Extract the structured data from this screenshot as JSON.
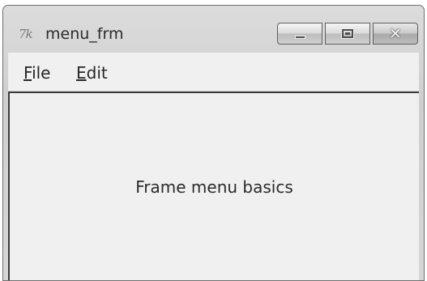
{
  "window": {
    "title": "menu_frm",
    "icon": "tk-feather-icon",
    "icon_text": "7k"
  },
  "caption_buttons": {
    "minimize": "minimize-icon",
    "maximize": "maximize-icon",
    "close": "close-icon",
    "close_glyph": "✕"
  },
  "menubar": {
    "items": [
      {
        "label_underlined": "F",
        "label_rest": "ile"
      },
      {
        "label_underlined": "E",
        "label_rest": "dit"
      }
    ]
  },
  "content": {
    "label": "Frame menu basics"
  },
  "colors": {
    "frame": "#d6d6d6",
    "surface": "#f0f0f0",
    "border": "#3b3b3b"
  }
}
